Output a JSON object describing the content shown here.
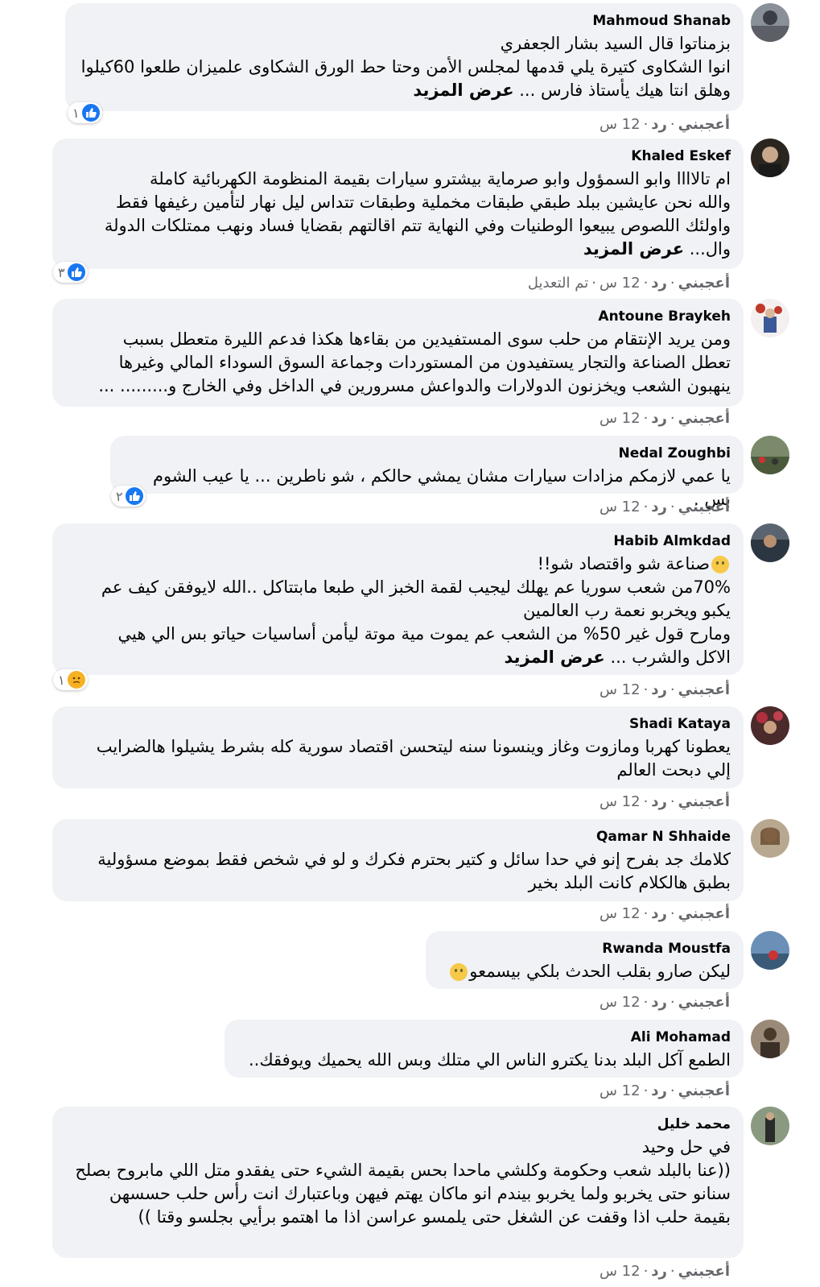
{
  "labels": {
    "like": "أعجبني",
    "reply": "رد",
    "dot": "·"
  },
  "comments": [
    {
      "author": "Mahmoud Shanab",
      "lines": [
        "بزمناتوا قال السيد بشار الجعفري",
        "انوا الشكاوى كتيرة يلي قدمها لمجلس الأمن وحتا حط الورق الشكاوى علميزان طلعوا 60كيلوا"
      ],
      "last": "وهلق انتا هيك يأستاذ فارس ...",
      "see_more": "عرض المزيد",
      "time": "12 س",
      "edited": "",
      "reaction": {
        "type": "like",
        "count": "١"
      }
    },
    {
      "author": "Khaled Eskef",
      "lines": [
        "ام تالاااا وابو السمؤول وابو صرماية بيشترو سيارات بقيمة المنظومة الكهربائية كاملة",
        "والله نحن عايشين ببلد طبقي طبقات مخملية وطبقات تتداس ليل نهار لتأمين رغيفها فقط",
        "واولئك اللصوص يبيعوا الوطنيات وفي النهاية تتم اقالتهم بقضايا فساد ونهب ممتلكات الدولة"
      ],
      "last": "وال...",
      "see_more": "عرض المزيد",
      "time": "12 س",
      "edited": "تم التعديل",
      "reaction": {
        "type": "like",
        "count": "٣"
      }
    },
    {
      "author": "Antoune Braykeh",
      "lines": [
        "ومن يريد الإنتقام من حلب سوى المستفيدين من بقاءها هكذا فدعم الليرة متعطل بسبب",
        "تعطل الصناعة والتجار يستفيدون من المستوردات وجماعة السوق السوداء المالي وغيرها",
        "ينهبون الشعب ويخزنون الدولارات والدواعش مسرورين في الداخل وفي الخارج و......... ..."
      ],
      "last": "",
      "see_more": "",
      "time": "12 س",
      "edited": "",
      "reaction": null
    },
    {
      "author": "Nedal Zoughbi",
      "lines": [
        "يا عمي لازمكم مزادات سيارات مشان يمشي حالكم ، شو ناطرين ... يا عيب الشوم بس ."
      ],
      "last": "",
      "see_more": "",
      "time": "12 س",
      "edited": "",
      "reaction": {
        "type": "like",
        "count": "٢"
      }
    },
    {
      "author": "Habib Almkdad",
      "lines": [
        "صناعة شو واقتصاد شو!!",
        "70%من شعب سوريا عم يهلك ليجيب لقمة الخبز الي طبعا مابتتاكل ..الله لايوفقن كيف عم",
        "يكبو ويخربو نعمة رب العالمين",
        "ومارح قول غير 50% من الشعب عم يموت مية موتة ليأمن أساسيات حياتو بس الي هيي"
      ],
      "last": "الاكل والشرب ...",
      "see_more": "عرض المزيد",
      "time": "12 س",
      "edited": "",
      "reaction": {
        "type": "sad",
        "count": "١"
      }
    },
    {
      "author": "Shadi Kataya",
      "lines": [
        "يعطونا كهربا ومازوت وغاز وينسونا سنه ليتحسن اقتصاد سورية كله بشرط يشيلوا هالضرايب",
        "إلي دبحت العالم"
      ],
      "last": "",
      "see_more": "",
      "time": "12 س",
      "edited": "",
      "reaction": null
    },
    {
      "author": "Qamar N Shhaide",
      "lines": [
        "كلامك جد بفرح إنو في حدا سائل و كتير بحترم فكرك و لو في شخص فقط بموضع مسؤولية",
        "بطبق هالكلام كانت البلد بخير"
      ],
      "last": "",
      "see_more": "",
      "time": "12 س",
      "edited": "",
      "reaction": null
    },
    {
      "author": "Rwanda Moustfa",
      "lines": [
        "ليكن صارو بقلب الحدث بلكي بيسمعو"
      ],
      "last": "",
      "see_more": "",
      "time": "12 س",
      "edited": "",
      "reaction": null
    },
    {
      "author": "Ali Mohamad",
      "lines": [
        "الطمع آكل البلد بدنا يكترو الناس الي متلك وبس الله يحميك ويوفقك.."
      ],
      "last": "",
      "see_more": "",
      "time": "12 س",
      "edited": "",
      "reaction": null
    },
    {
      "author": "محمد خليل",
      "lines": [
        "في حل وحيد",
        "((عنا بالبلد شعب وحكومة وكلشي ماحدا بحس بقيمة الشيء حتى يفقدو متل اللي مابروح بصلح",
        "سنانو حتى يخربو ولما يخربو بيندم انو ماكان يهتم فيهن وباعتبارك انت رأس حلب حسسهن",
        "بقيمة حلب اذا وقفت عن الشغل حتى يلمسو عراسن اذا ما اهتمو برأيي بجلسو وقتا ))"
      ],
      "last": "",
      "see_more": "",
      "time": "12 س",
      "edited": "",
      "reaction": null
    }
  ]
}
